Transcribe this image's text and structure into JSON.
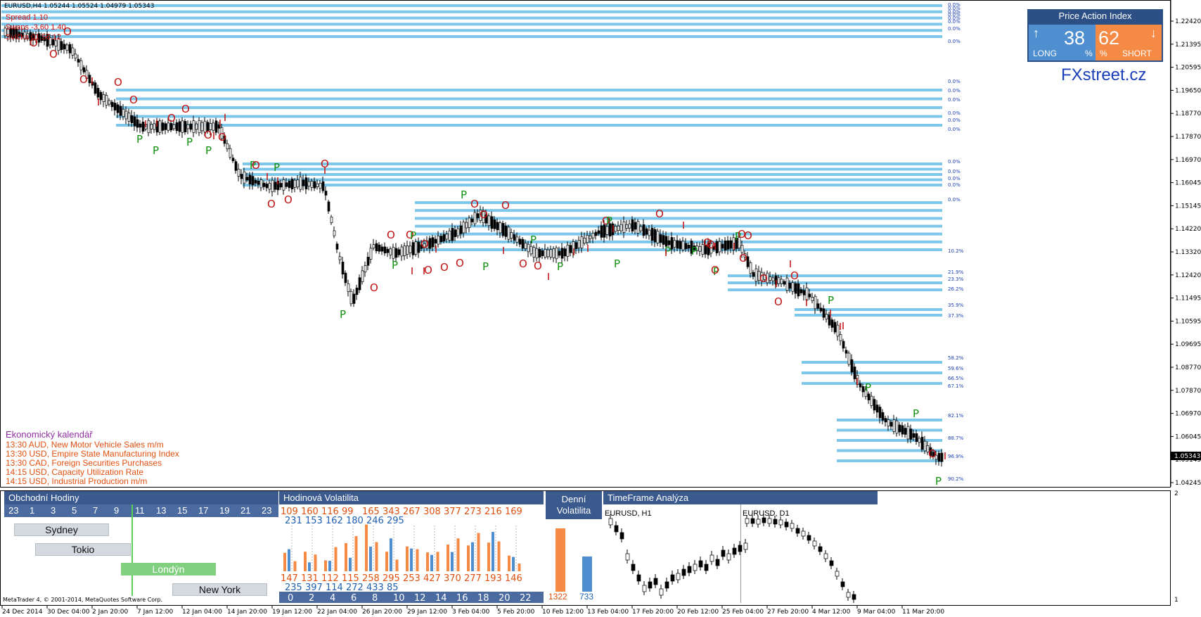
{
  "symbol_header": "EURUSD,H4  1.05244 1.05524 1.04979 1.05343",
  "info_lines": [
    "Spread  1.10",
    "Swaps  -3.60  1.40",
    "Svíčka  01:56:12"
  ],
  "price_labels": [
    "1.22420",
    "1.21395",
    "1.20595",
    "1.19650",
    "1.18770",
    "1.17870",
    "1.16970",
    "1.16045",
    "1.15145",
    "1.14220",
    "1.13320",
    "1.12420",
    "1.11495",
    "1.10595",
    "1.09695",
    "1.08770",
    "1.07870",
    "1.06970",
    "1.06045",
    "1.05145",
    "1.04245"
  ],
  "current_price": "1.05343",
  "date_labels": [
    "24 Dec 2014",
    "30 Dec 04:00",
    "2 Jan 20:00",
    "7 Jan 12:00",
    "12 Jan 04:00",
    "14 Jan 20:00",
    "19 Jan 12:00",
    "22 Jan 04:00",
    "26 Jan 20:00",
    "29 Jan 12:00",
    "3 Feb 04:00",
    "5 Feb 20:00",
    "10 Feb 12:00",
    "13 Feb 04:00",
    "17 Feb 20:00",
    "20 Feb 12:00",
    "25 Feb 04:00",
    "27 Feb 20:00",
    "4 Mar 12:00",
    "9 Mar 04:00",
    "11 Mar 20:00"
  ],
  "level_pct_labels": [
    "0.0%",
    "0.0%",
    "0.0%",
    "0.0%",
    "0.0%",
    "0.0%",
    "0.0%",
    "0.0%",
    "0.0%",
    "0.0%",
    "0.0%",
    "0.0%",
    "0.0%",
    "0.0%",
    "0.0%",
    "0.0%",
    "0.0%",
    "0.0%",
    "0.0%",
    "10.2%",
    "21.9%",
    "23.3%",
    "26.2%",
    "35.9%",
    "37.3%",
    "58.2%",
    "59.6%",
    "66.5%",
    "67.1%",
    "82.1%",
    "88.7%",
    "96.9%",
    "90.2%"
  ],
  "price_action_index": {
    "title": "Price Action Index",
    "long_value": "38",
    "long_label": "LONG",
    "short_value": "62",
    "short_label": "SHORT",
    "pct": "%",
    "up_arrow": "↑",
    "down_arrow": "↓"
  },
  "brand": "FXstreet.cz",
  "calendar": {
    "title": "Ekonomický kalendář",
    "events": [
      "13:30 AUD, New Motor Vehicle Sales m/m",
      "13:30 USD, Empire State Manufacturing Index",
      "13:30 CAD, Foreign Securities Purchases",
      "14:15 USD, Capacity Utilization Rate",
      "14:15 USD, Industrial Production m/m"
    ]
  },
  "trading_hours": {
    "title": "Obchodní Hodiny",
    "hours": [
      "23",
      "1",
      "3",
      "5",
      "7",
      "9",
      "11",
      "13",
      "15",
      "17",
      "19",
      "21",
      "23"
    ],
    "sessions": [
      {
        "name": "Sydney",
        "active": false
      },
      {
        "name": "Tokio",
        "active": false
      },
      {
        "name": "Londýn",
        "active": true
      },
      {
        "name": "New York",
        "active": false
      }
    ]
  },
  "hourly_volatility": {
    "title": "Hodinová Volatilita",
    "top_row1": [
      "109",
      "160",
      "116",
      "99",
      "165",
      "343",
      "267",
      "308",
      "377",
      "273",
      "216",
      "169"
    ],
    "top_row2": [
      "231",
      "153",
      "162",
      "180",
      "246",
      "295"
    ],
    "bottom_row1": [
      "147",
      "131",
      "112",
      "115",
      "258",
      "295",
      "253",
      "427",
      "370",
      "277",
      "193",
      "146"
    ],
    "bottom_row2": [
      "235",
      "397",
      "114",
      "272",
      "433",
      "85"
    ],
    "hours": [
      "0",
      "2",
      "4",
      "6",
      "8",
      "10",
      "12",
      "14",
      "16",
      "18",
      "20",
      "22"
    ],
    "orange_bars": [
      109,
      60,
      116,
      99,
      65,
      143,
      167,
      208,
      277,
      173,
      116,
      69,
      147,
      131,
      112,
      115,
      158,
      195,
      153,
      227,
      170,
      177,
      93,
      46
    ],
    "blue_bars": [
      131,
      53,
      62,
      80,
      146,
      195,
      135,
      97,
      114,
      172,
      233,
      85
    ]
  },
  "daily_volatility": {
    "title_line1": "Denní",
    "title_line2": "Volatilita",
    "orange_value": "1322",
    "blue_value": "733"
  },
  "timeframe_analysis": {
    "title": "TimeFrame Analýza",
    "chart1": "EURUSD, H1",
    "chart2": "EURUSD, D1"
  },
  "indicator_scale_top": "2",
  "indicator_scale_bottom": "1",
  "copyright": "MetaTrader 4, © 2001-2014, MetaQuotes Software Corp.",
  "colors": {
    "level_line": "#7dc8ea",
    "panel_header": "#3a5a8e",
    "orange": "#f58a45",
    "blue": "#4f8fd0",
    "signal_P": "#109010",
    "signal_O": "#c01010",
    "calendar_title": "#9030a0",
    "calendar_event": "#e05010"
  }
}
